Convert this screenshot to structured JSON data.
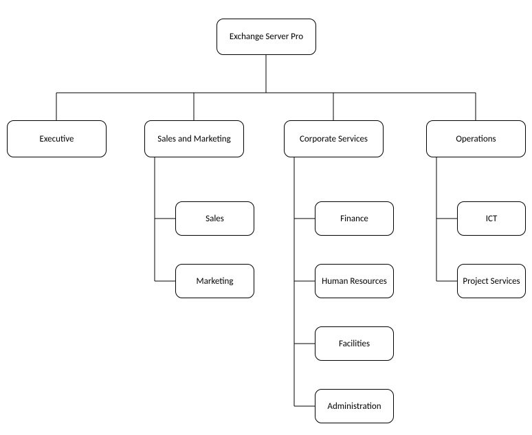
{
  "org": {
    "root": "Exchange Server Pro",
    "level1": {
      "executive": "Executive",
      "sales_marketing": "Sales and Marketing",
      "corporate_services": "Corporate Services",
      "operations": "Operations"
    },
    "sales_marketing_children": {
      "sales": "Sales",
      "marketing": "Marketing"
    },
    "corporate_services_children": {
      "finance": "Finance",
      "human_resources": "Human Resources",
      "facilities": "Facilities",
      "administration": "Administration"
    },
    "operations_children": {
      "ict": "ICT",
      "project_services": "Project Services"
    }
  }
}
